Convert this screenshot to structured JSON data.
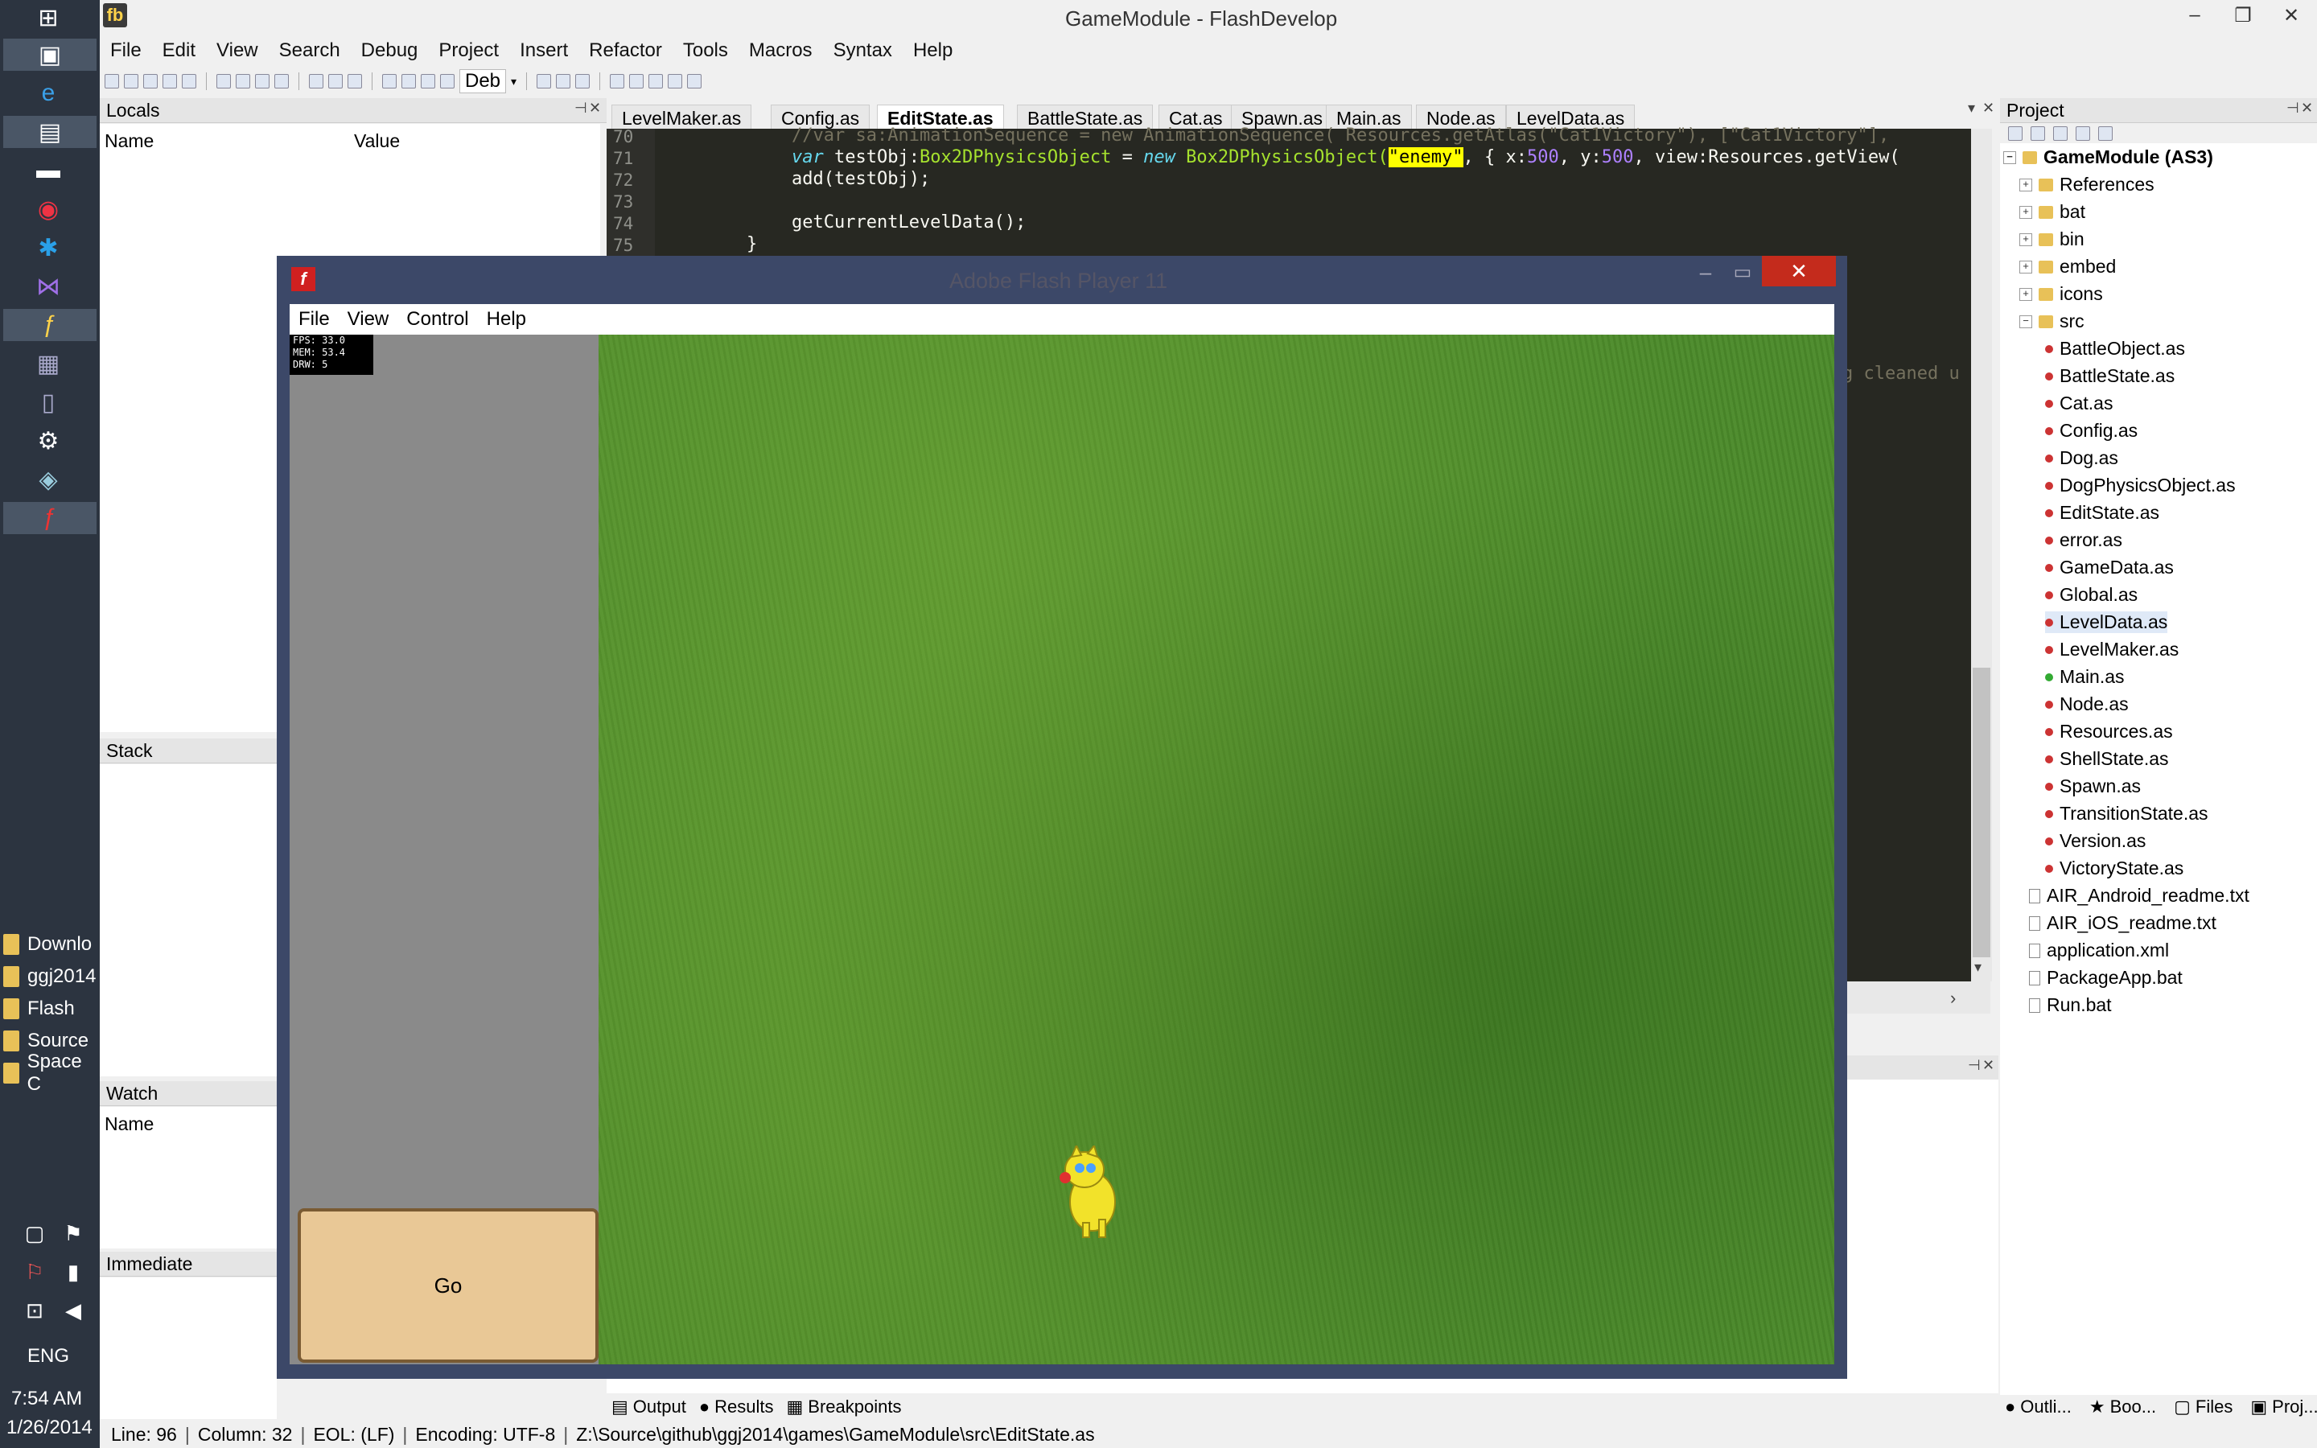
{
  "window": {
    "title": "GameModule - FlashDevelop",
    "app_icon": "fb",
    "min": "–",
    "max": "❐",
    "close": "✕"
  },
  "menu": [
    "File",
    "Edit",
    "View",
    "Search",
    "Debug",
    "Project",
    "Insert",
    "Refactor",
    "Tools",
    "Macros",
    "Syntax",
    "Help"
  ],
  "toolbar": {
    "config_label": "Deb"
  },
  "locals": {
    "title": "Locals",
    "col_name": "Name",
    "col_value": "Value"
  },
  "stack": {
    "title": "Stack"
  },
  "watch": {
    "title": "Watch",
    "col_name": "Name"
  },
  "immediate": {
    "title": "Immediate"
  },
  "editor": {
    "tabs": [
      "LevelMaker.as",
      "Config.as",
      "EditState.as",
      "BattleState.as",
      "Cat.as",
      "Spawn.as",
      "Main.as",
      "Node.as",
      "LevelData.as"
    ],
    "active_tab": "EditState.as",
    "line_numbers": [
      "70",
      "71",
      "72",
      "73",
      "74",
      "75"
    ],
    "code": {
      "l70": "//var sa:AnimationSequence = new AnimationSequence( Resources.getAtlas(\"Cat1Victory\"), [\"Cat1Victory\"],",
      "l71_a": "var",
      "l71_b": " testObj:",
      "l71_c": "Box2DPhysicsObject",
      "l71_d": " = ",
      "l71_e": "new",
      "l71_f": " Box2DPhysicsObject(",
      "l71_g": "\"enemy\"",
      "l71_h": ", { x:",
      "l71_i": "500",
      "l71_j": ", y:",
      "l71_k": "500",
      "l71_l": ", view:Resources.getView(",
      "l72": "add(testObj);",
      "l74": "getCurrentLevelData();",
      "l75": "}",
      "partial_comment": "g cleaned u"
    }
  },
  "project": {
    "title": "Project",
    "root": "GameModule (AS3)",
    "folders": [
      "References",
      "bat",
      "bin",
      "embed",
      "icons",
      "src"
    ],
    "src_files": [
      "BattleObject.as",
      "BattleState.as",
      "Cat.as",
      "Config.as",
      "Dog.as",
      "DogPhysicsObject.as",
      "EditState.as",
      "error.as",
      "GameData.as",
      "Global.as",
      "LevelData.as",
      "LevelMaker.as",
      "Main.as",
      "Node.as",
      "Resources.as",
      "ShellState.as",
      "Spawn.as",
      "TransitionState.as",
      "Version.as",
      "VictoryState.as"
    ],
    "root_files": [
      "AIR_Android_readme.txt",
      "AIR_iOS_readme.txt",
      "application.xml",
      "PackageApp.bat",
      "Run.bat"
    ],
    "selected_file": "LevelData.as"
  },
  "flash_player": {
    "title": "Adobe Flash Player 11",
    "menu": [
      "File",
      "View",
      "Control",
      "Help"
    ],
    "stats": [
      "FPS: 33.0",
      "MEM: 53.4",
      "DRW: 5"
    ],
    "go_label": "Go"
  },
  "bottom_tabs_left": [
    "Output",
    "Results",
    "Breakpoints"
  ],
  "bottom_tabs_right": [
    "Outli...",
    "Boo...",
    "Files",
    "Proj..."
  ],
  "status": {
    "line": "Line: 96",
    "column": "Column: 32",
    "eol": "EOL: (LF)",
    "encoding": "Encoding: UTF-8",
    "path": "Z:\\Source\\github\\ggj2014\\games\\GameModule\\src\\EditState.as"
  },
  "taskbar": {
    "folders": [
      "Downlo",
      "ggj2014",
      "Flash",
      "Source",
      "Space C"
    ],
    "lang": "ENG",
    "time": "7:54 AM",
    "date": "1/26/2014"
  }
}
